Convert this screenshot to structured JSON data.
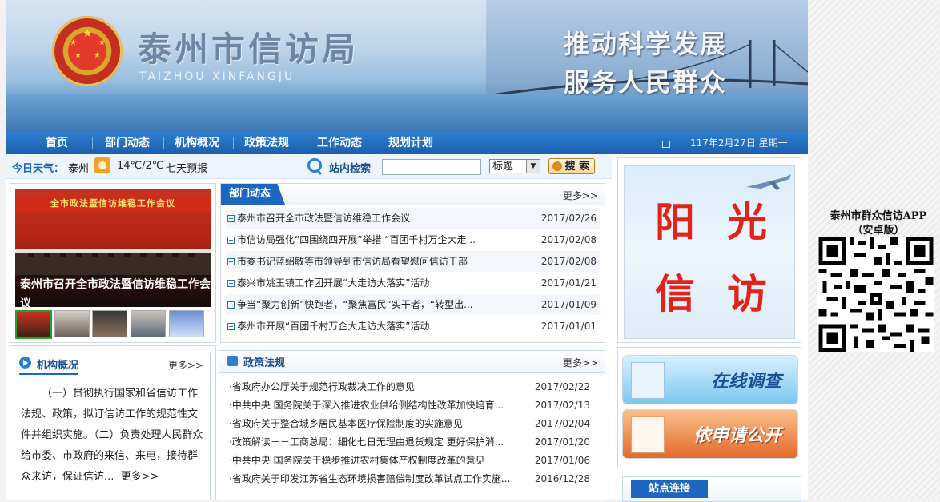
{
  "site": {
    "title": "泰州市信访局",
    "subtitle": "TAIZHOU XINFANGJU",
    "slogan_line1": "推动科学发展",
    "slogan_line2": "服务人民群众"
  },
  "nav": {
    "items": [
      "首页",
      "部门动态",
      "机构概况",
      "政策法规",
      "工作动态",
      "规划计划"
    ],
    "date": "117年2月27日 星期一"
  },
  "weather": {
    "label": "今日天气：",
    "city": "泰州",
    "temp": "14℃/2℃",
    "forecast_link": "七天预报"
  },
  "search": {
    "label": "站内检索",
    "input_value": "",
    "select_value": "标题",
    "button_label": "搜 索"
  },
  "photo": {
    "banner_text": "全市政法暨信访维稳工作会议",
    "caption": "泰州市召开全市政法暨信访维稳工作会议"
  },
  "dept_news": {
    "title": "部门动态",
    "more": "更多>>",
    "items": [
      {
        "title": "泰州市召开全市政法暨信访维稳工作会议",
        "date": "2017/02/26"
      },
      {
        "title": "市信访局强化“四围绕四开展”举措 “百团千村万企大走...",
        "date": "2017/02/08"
      },
      {
        "title": "市委书记蓝绍敏等市领导到市信访局看望慰问信访干部",
        "date": "2017/02/08"
      },
      {
        "title": "泰兴市姚王镇工作团开展“大走访大落实”活动",
        "date": "2017/01/21"
      },
      {
        "title": "争当“聚力创新”快跑者，“聚焦富民”实干者，“转型出...",
        "date": "2017/01/09"
      },
      {
        "title": "泰州市开展“百团千村万企大走访大落实”活动",
        "date": "2017/01/01"
      }
    ]
  },
  "org": {
    "title": "机构概况",
    "more": "更多>>",
    "text": "（一）贯彻执行国家和省信访工作法规、政策，拟订信访工作的规范性文件并组织实施。（二）负责处理人民群众给市委、市政府的来信、来电，接待群众来访，保证信访...",
    "inline_more": "更多>>"
  },
  "policy": {
    "title": "政策法规",
    "more": "更多>>",
    "items": [
      {
        "title": "·省政府办公厅关于规范行政裁决工作的意见",
        "date": "2017/02/22"
      },
      {
        "title": "·中共中央 国务院关于深入推进农业供给侧结构性改革加快培育...",
        "date": "2017/02/13"
      },
      {
        "title": "·省政府关于整合城乡居民基本医疗保险制度的实施意见",
        "date": "2017/02/04"
      },
      {
        "title": "·政策解读－－工商总局：细化七日无理由退货规定 更好保护消...",
        "date": "2017/01/20"
      },
      {
        "title": "·中共中央 国务院关于稳步推进农村集体产权制度改革的意见",
        "date": "2017/01/06"
      },
      {
        "title": "·省政府关于印发江苏省生态环境损害赔偿制度改革试点工作实施...",
        "date": "2016/12/28"
      }
    ]
  },
  "right": {
    "sun_chars": [
      "阳",
      "光",
      "信",
      "访"
    ],
    "survey_label": "在线调查",
    "apply_label": "依申请公开",
    "links_title": "站点连接"
  },
  "app": {
    "label_line1": "泰州市群众信访APP",
    "label_line2": "（安卓版）"
  },
  "colors": {
    "nav_blue": "#1d66bf",
    "accent_red": "#e2231a"
  }
}
